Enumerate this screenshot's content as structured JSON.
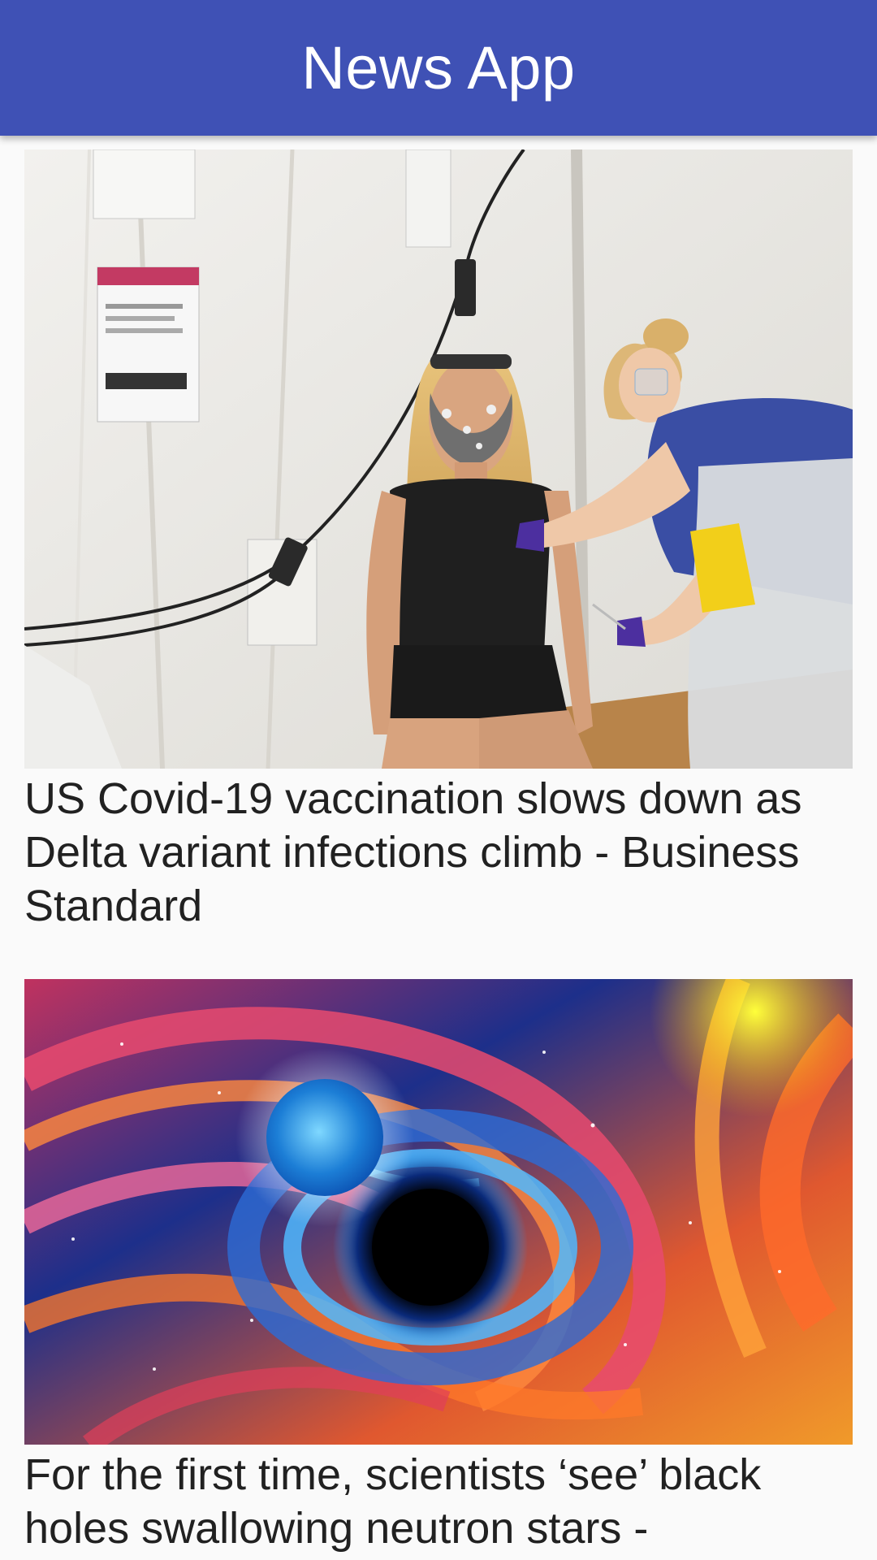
{
  "app": {
    "title": "News App"
  },
  "articles": [
    {
      "headline": "US Covid-19 vaccination slows down as Delta variant infections climb - Business Standard",
      "image_icon": "vaccination-photo"
    },
    {
      "headline": "For the first time, scientists ‘see’ black holes swallowing neutron stars -",
      "image_icon": "black-hole-illustration"
    }
  ],
  "colors": {
    "appbar": "#3f51b5",
    "background": "#fafafa",
    "headline_text": "#212121"
  }
}
